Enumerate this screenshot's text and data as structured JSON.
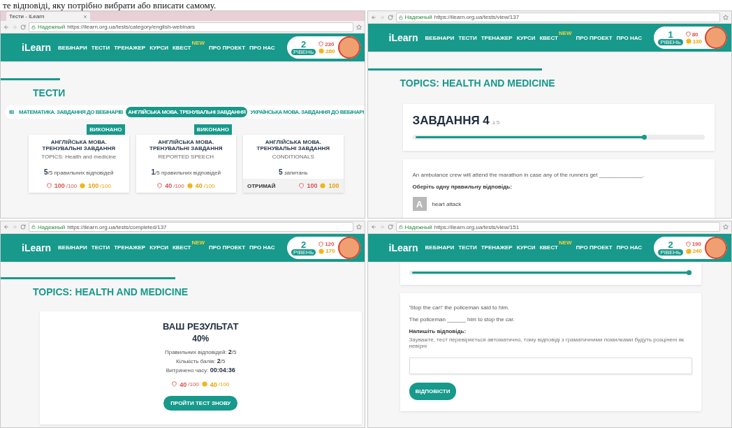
{
  "document_text": "те відповіді, яку потрібно вибрати або вписати самому.",
  "windows": [
    {
      "kind": "category",
      "tab_title": "Тести - iLearn",
      "security": "Надежный",
      "url": "https://ilearn.org.ua/tests/category/english-webinars",
      "logo": "iLearn",
      "nav": [
        {
          "label": "ВЕБІНАРИ"
        },
        {
          "label": "ТЕСТИ"
        },
        {
          "label": "ТРЕНАЖЕР"
        },
        {
          "label": "КУРСИ"
        },
        {
          "label": "КВЕСТ",
          "badge": "NEW"
        },
        {
          "label": "ПРО ПРОЕКТ"
        },
        {
          "label": "ПРО НАС"
        }
      ],
      "level": "2",
      "level_label": "РІВЕНЬ",
      "shields": "230",
      "coins": "280",
      "heading": "ТЕСТИ",
      "categories": [
        {
          "label": "ІВ",
          "selected": false
        },
        {
          "label": "МАТЕМАТИКА. ЗАВДАННЯ ДО ВЕБІНАРІВ",
          "selected": false
        },
        {
          "label": "АНГЛІЙСЬКА МОВА. ТРЕНУВАЛЬНІ ЗАВДАННЯ",
          "selected": true
        },
        {
          "label": "УКРАЇНСЬКА МОВА. ЗАВДАННЯ ДО ВЕБІНАРІ",
          "selected": false
        }
      ],
      "cards": [
        {
          "status": "ВИКОНАНО",
          "title": "АНГЛІЙСЬКА МОВА. ТРЕНУВАЛЬНІ ЗАВДАННЯ",
          "subtitle": "TOPICS: Health and medicine",
          "count": "**5**/5 правильних відповідей",
          "shield": "**100**/100",
          "coin": "**100**/100"
        },
        {
          "status": "ВИКОНАНО",
          "title": "АНГЛІЙСЬКА МОВА. ТРЕНУВАЛЬНІ ЗАВДАННЯ",
          "subtitle": "REPORTED SPEECH",
          "count": "**1**/5 правильних відповідей",
          "shield": "**40**/100",
          "coin": "**40**/100"
        },
        {
          "title": "АНГЛІЙСЬКА МОВА. ТРЕНУВАЛЬНІ ЗАВДАННЯ",
          "subtitle": "CONDITIONALS",
          "count": "**5** запитань",
          "action": "ОТРИМАЙ",
          "shield": "**100**",
          "coin": "**100**"
        }
      ]
    },
    {
      "kind": "choice",
      "security": "Надежный",
      "url": "https://ilearn.org.ua/tests/view/137",
      "logo": "iLearn",
      "nav": [
        {
          "label": "ВЕБІНАРИ"
        },
        {
          "label": "ТЕСТИ"
        },
        {
          "label": "ТРЕНАЖЕР"
        },
        {
          "label": "КУРСИ"
        },
        {
          "label": "КВЕСТ",
          "badge": "NEW"
        },
        {
          "label": "ПРО ПРОЕКТ"
        },
        {
          "label": "ПРО НАС"
        }
      ],
      "level": "1",
      "level_label": "РІВЕНЬ",
      "shields": "80",
      "coins": "130",
      "heading": "TOPICS: HEALTH AND MEDICINE",
      "task": "ЗАВДАННЯ 4",
      "task_of": "з 5",
      "progress": {
        "level": 0.8
      },
      "question": [
        "An ambulance crew will attend the marathon in case any of the runners get ______________."
      ],
      "prompt": "Оберіть одну правильну відповідь:",
      "options": [
        {
          "letter": "A",
          "text": "heart attack"
        }
      ]
    },
    {
      "kind": "result",
      "security": "Надежный",
      "url": "https://ilearn.org.ua/tests/completed/137",
      "logo": "iLearn",
      "nav": [
        {
          "label": "ВЕБІНАРИ"
        },
        {
          "label": "ТЕСТИ"
        },
        {
          "label": "ТРЕНАЖЕР"
        },
        {
          "label": "КУРСИ"
        },
        {
          "label": "КВЕСТ",
          "badge": "NEW"
        },
        {
          "label": "ПРО ПРОЕКТ"
        },
        {
          "label": "ПРО НАС"
        }
      ],
      "level": "2",
      "level_label": "РІВЕНЬ",
      "shields": "120",
      "coins": "170",
      "heading": "TOPICS: HEALTH AND MEDICINE",
      "result_title": "ВАШ РЕЗУЛЬТАТ",
      "percent": "40%",
      "stats": [
        "Правильних відповідей: **2**/5",
        "Кількість балів: **2**/5",
        "Витрачено часу: **00:04:36**"
      ],
      "shield": "**40**/100",
      "coin": "**40**/100",
      "button": "ПРОЙТИ ТЕСТ ЗНОВУ"
    },
    {
      "kind": "write",
      "security": "Надежный",
      "url": "https://ilearn.org.ua/tests/view/151",
      "logo": "iLearn",
      "nav": [
        {
          "label": "ВЕБІНАРИ"
        },
        {
          "label": "ТЕСТИ"
        },
        {
          "label": "ТРЕНАЖЕР"
        },
        {
          "label": "КУРСИ"
        },
        {
          "label": "КВЕСТ",
          "badge": "NEW"
        },
        {
          "label": "ПРО ПРОЕКТ"
        },
        {
          "label": "ПРО НАС"
        }
      ],
      "level": "2",
      "level_label": "РІВЕНЬ",
      "shields": "190",
      "coins": "240",
      "progress": {
        "level": 1
      },
      "question": [
        "'Stop the car!' the policeman said to him.",
        "The policeman ______ him to stop the car."
      ],
      "prompt": "Напишіть відповідь:",
      "note": "Зауважте, тест перевіряється автоматично, тому відповіді з граматичними помилками будуть розцінені як невірні",
      "button": "ВІДПОВІСТИ"
    }
  ]
}
